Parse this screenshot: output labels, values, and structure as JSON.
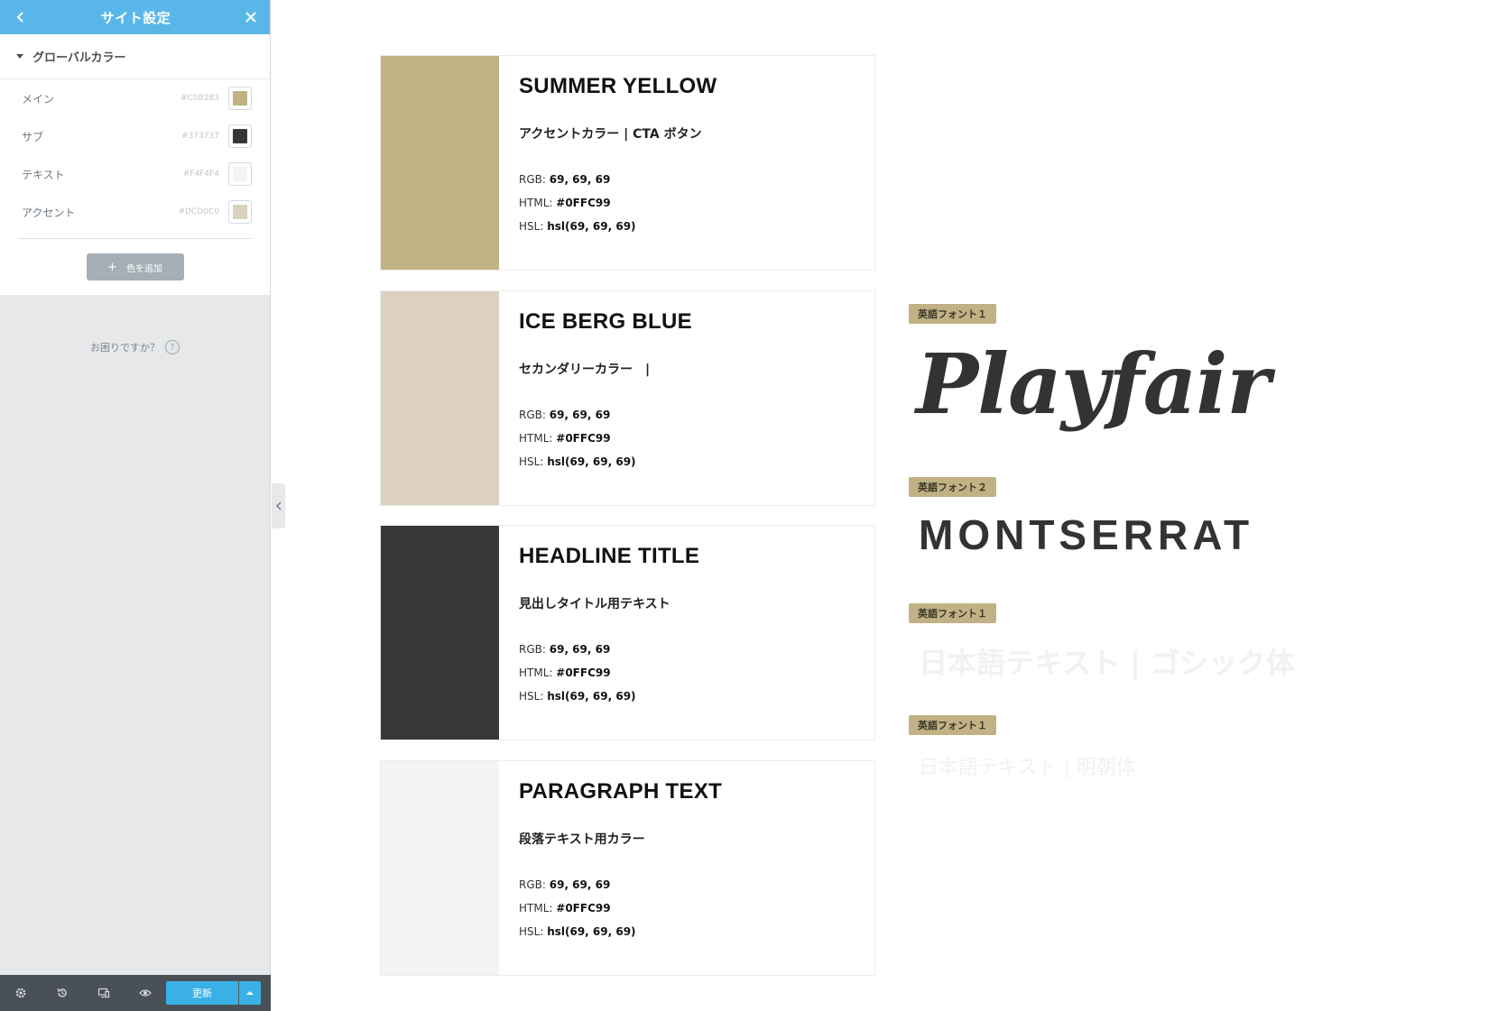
{
  "sidebar": {
    "header_title": "サイト設定",
    "section_title": "グローバルカラー",
    "colors": [
      {
        "name": "メイン",
        "hex": "#C0B283",
        "swatch": "#C0B283"
      },
      {
        "name": "サブ",
        "hex": "#373737",
        "swatch": "#373737"
      },
      {
        "name": "テキスト",
        "hex": "#F4F4F4",
        "swatch": "#F4F4F4"
      },
      {
        "name": "アクセント",
        "hex": "#DCD0C0",
        "swatch": "#DCD0C0"
      }
    ],
    "add_color_label": "色を追加",
    "help_text": "お困りですか？",
    "publish_label": "更新",
    "accent_color": "#58b7e8"
  },
  "cards": [
    {
      "title": "SUMMER YELLOW",
      "subtitle": "アクセントカラー | CTA ボタン",
      "color": "#C0B283",
      "rgb_label": "RGB:",
      "rgb": "69, 69, 69",
      "html_label": "HTML:",
      "html": "#0FFC99",
      "hsl_label": "HSL:",
      "hsl": "hsl(69, 69, 69)"
    },
    {
      "title": "ICE BERG BLUE",
      "subtitle": "セカンダリーカラー　|",
      "color": "#DCD0C0",
      "rgb_label": "RGB:",
      "rgb": "69, 69, 69",
      "html_label": "HTML:",
      "html": "#0FFC99",
      "hsl_label": "HSL:",
      "hsl": "hsl(69, 69, 69)"
    },
    {
      "title": "HEADLINE TITLE",
      "subtitle": "見出しタイトル用テキスト",
      "color": "#373737",
      "rgb_label": "RGB:",
      "rgb": "69, 69, 69",
      "html_label": "HTML:",
      "html": "#0FFC99",
      "hsl_label": "HSL:",
      "hsl": "hsl(69, 69, 69)"
    },
    {
      "title": "PARAGRAPH TEXT",
      "subtitle": "段落テキスト用カラー",
      "color": "#F4F4F4",
      "rgb_label": "RGB:",
      "rgb": "69, 69, 69",
      "html_label": "HTML:",
      "html": "#0FFC99",
      "hsl_label": "HSL:",
      "hsl": "hsl(69, 69, 69)"
    }
  ],
  "fonts": [
    {
      "badge": "英語フォント１",
      "sample": "Playfair"
    },
    {
      "badge": "英語フォント２",
      "sample": "MONTSERRAT"
    },
    {
      "badge": "英語フォント１",
      "sample": "日本語テキスト | ゴシック体"
    },
    {
      "badge": "英語フォント１",
      "sample": "日本語テキスト | 明朝体"
    }
  ]
}
